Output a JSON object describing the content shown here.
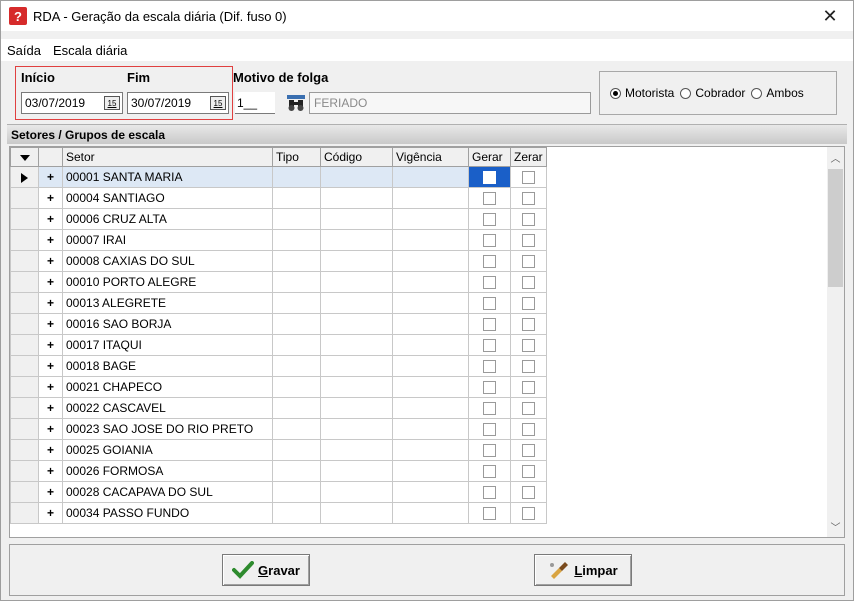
{
  "window": {
    "title": "RDA - Geração da escala diária (Dif. fuso 0)",
    "icon_glyph": "?",
    "close_glyph": "✕"
  },
  "menu": {
    "items": [
      "Saída",
      "Escala diária"
    ]
  },
  "filters": {
    "inicio_label": "Início",
    "fim_label": "Fim",
    "motivo_label": "Motivo de folga",
    "inicio_value": "03/07/2019",
    "fim_value": "30/07/2019",
    "calendar_glyph": "15",
    "motivo_code": "1__",
    "motivo_desc": "FERIADO"
  },
  "radios": {
    "options": [
      "Motorista",
      "Cobrador",
      "Ambos"
    ],
    "selected": "Motorista"
  },
  "section": {
    "title": "Setores / Grupos de escala"
  },
  "grid": {
    "columns": [
      "Setor",
      "Tipo",
      "Código",
      "Vigência",
      "Gerar",
      "Zerar"
    ],
    "rows": [
      "00001 SANTA MARIA",
      "00004 SANTIAGO",
      "00006 CRUZ ALTA",
      "00007 IRAI",
      "00008 CAXIAS DO SUL",
      "00010 PORTO ALEGRE",
      "00013 ALEGRETE",
      "00016 SAO BORJA",
      "00017 ITAQUI",
      "00018 BAGE",
      "00021 CHAPECO",
      "00022 CASCAVEL",
      "00023 SAO JOSE DO RIO PRETO",
      "00025 GOIANIA",
      "00026 FORMOSA",
      "00028 CACAPAVA DO SUL",
      "00034 PASSO FUNDO"
    ],
    "expand_glyph": "+"
  },
  "buttons": {
    "gravar": {
      "mnemonic": "G",
      "rest": "ravar"
    },
    "limpar": {
      "mnemonic": "L",
      "rest": "impar"
    }
  },
  "colors": {
    "accent_selected": "#1a5fc8",
    "highlight_border": "#e04040",
    "icon_red": "#d62b2b"
  }
}
